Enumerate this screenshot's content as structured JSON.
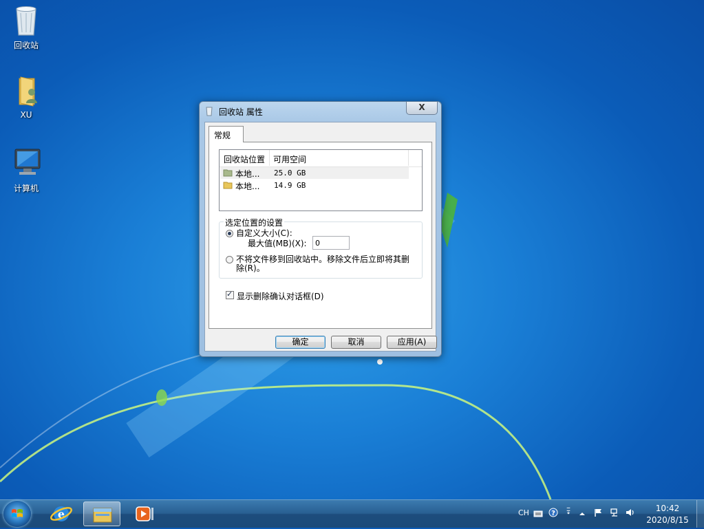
{
  "desktop": {
    "icons": [
      {
        "label": "回收站",
        "icon": "recycle-bin-icon"
      },
      {
        "label": "XU",
        "icon": "user-folder-icon"
      },
      {
        "label": "计算机",
        "icon": "computer-icon"
      }
    ]
  },
  "dialog": {
    "title": "回收站 属性",
    "close_label": "X",
    "tab": "常规",
    "list": {
      "headers": [
        "回收站位置",
        "可用空间"
      ],
      "rows": [
        {
          "name": "本地...",
          "space": "25.0 GB",
          "selected": true
        },
        {
          "name": "本地...",
          "space": "14.9 GB",
          "selected": false
        }
      ]
    },
    "group": {
      "title": "选定位置的设置",
      "custom_size_label": "自定义大小(C):",
      "max_size_label": "最大值(MB)(X):",
      "max_size_value": "0",
      "no_move_label_line1": "不将文件移到回收站中。移除文件后立即将其删",
      "no_move_label_line2": "除(R)。"
    },
    "confirm_checkbox_label": "显示删除确认对话框(D)",
    "buttons": {
      "ok": "确定",
      "cancel": "取消",
      "apply": "应用(A)"
    }
  },
  "taskbar": {
    "language": "CH",
    "time": "10:42",
    "date": "2020/8/15"
  }
}
